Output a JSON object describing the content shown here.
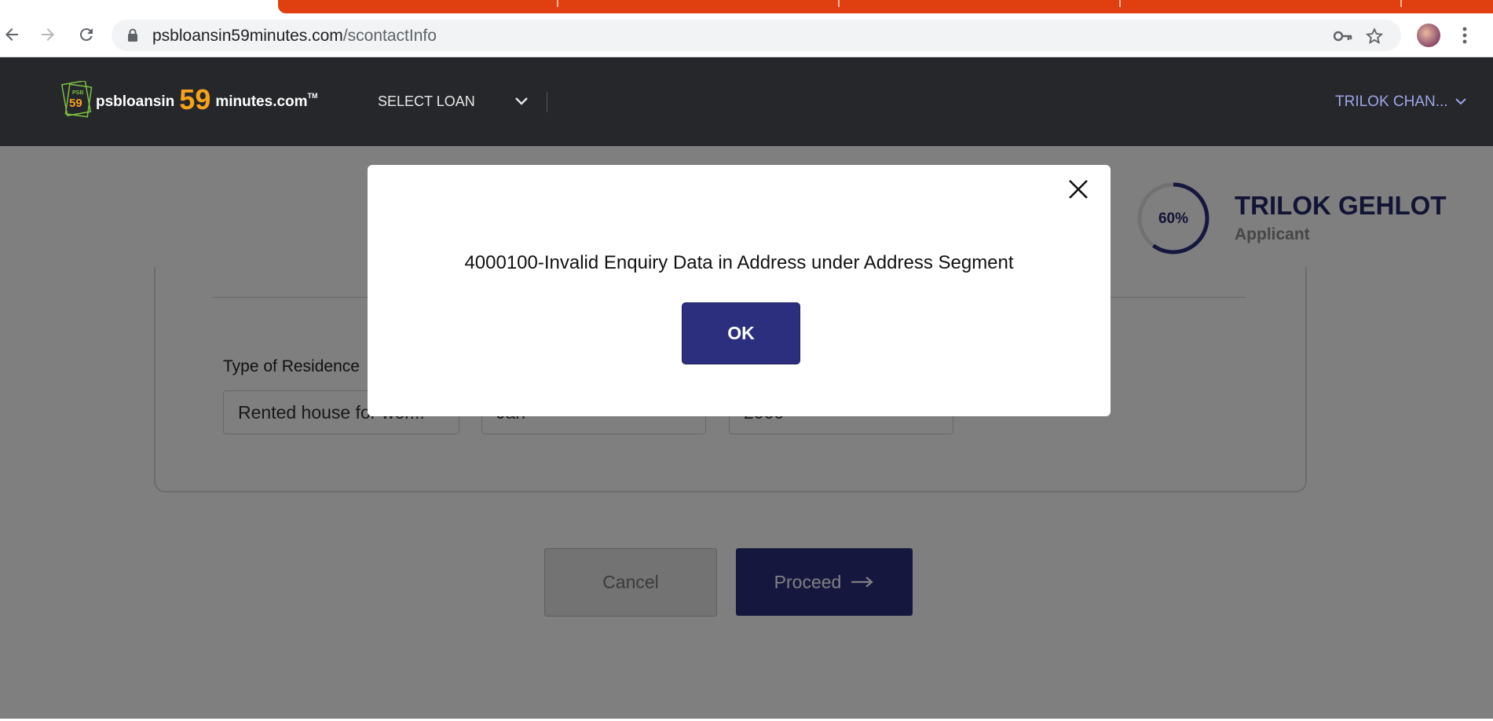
{
  "browser": {
    "url_host": "psbloansin59minutes.com",
    "url_path": "/scontactInfo",
    "icons": [
      "back-arrow-icon",
      "forward-arrow-icon",
      "reload-icon",
      "lock-icon",
      "key-icon",
      "star-icon",
      "profile-avatar",
      "more-vert-icon"
    ]
  },
  "header": {
    "logo": {
      "badge_top": "PSB",
      "badge_num": "59",
      "brand_prefix": "psbloansin",
      "brand_num": "59",
      "brand_suffix": "minutes.com",
      "tm": "TM"
    },
    "select_loan_label": "SELECT LOAN",
    "user_menu_label": "TRILOK CHAN..."
  },
  "profile": {
    "progress_text": "60%",
    "progress_value": 0.6,
    "name": "TRILOK GEHLOT",
    "role": "Applicant"
  },
  "form": {
    "residence_label": "Type of Residence",
    "selects": [
      {
        "value": "Rented house for wor..."
      },
      {
        "value": "Jan"
      },
      {
        "value": "2000"
      }
    ]
  },
  "actions": {
    "cancel_label": "Cancel",
    "proceed_label": "Proceed"
  },
  "modal": {
    "message": "4000100-Invalid Enquiry Data in Address under Address Segment",
    "ok_label": "OK"
  },
  "colors": {
    "primary": "#2b2f7e",
    "header_bg": "#26272b",
    "tab_orange": "#e0400f",
    "logo_orange": "#f7a21b",
    "user_menu": "#9ea6e8"
  }
}
